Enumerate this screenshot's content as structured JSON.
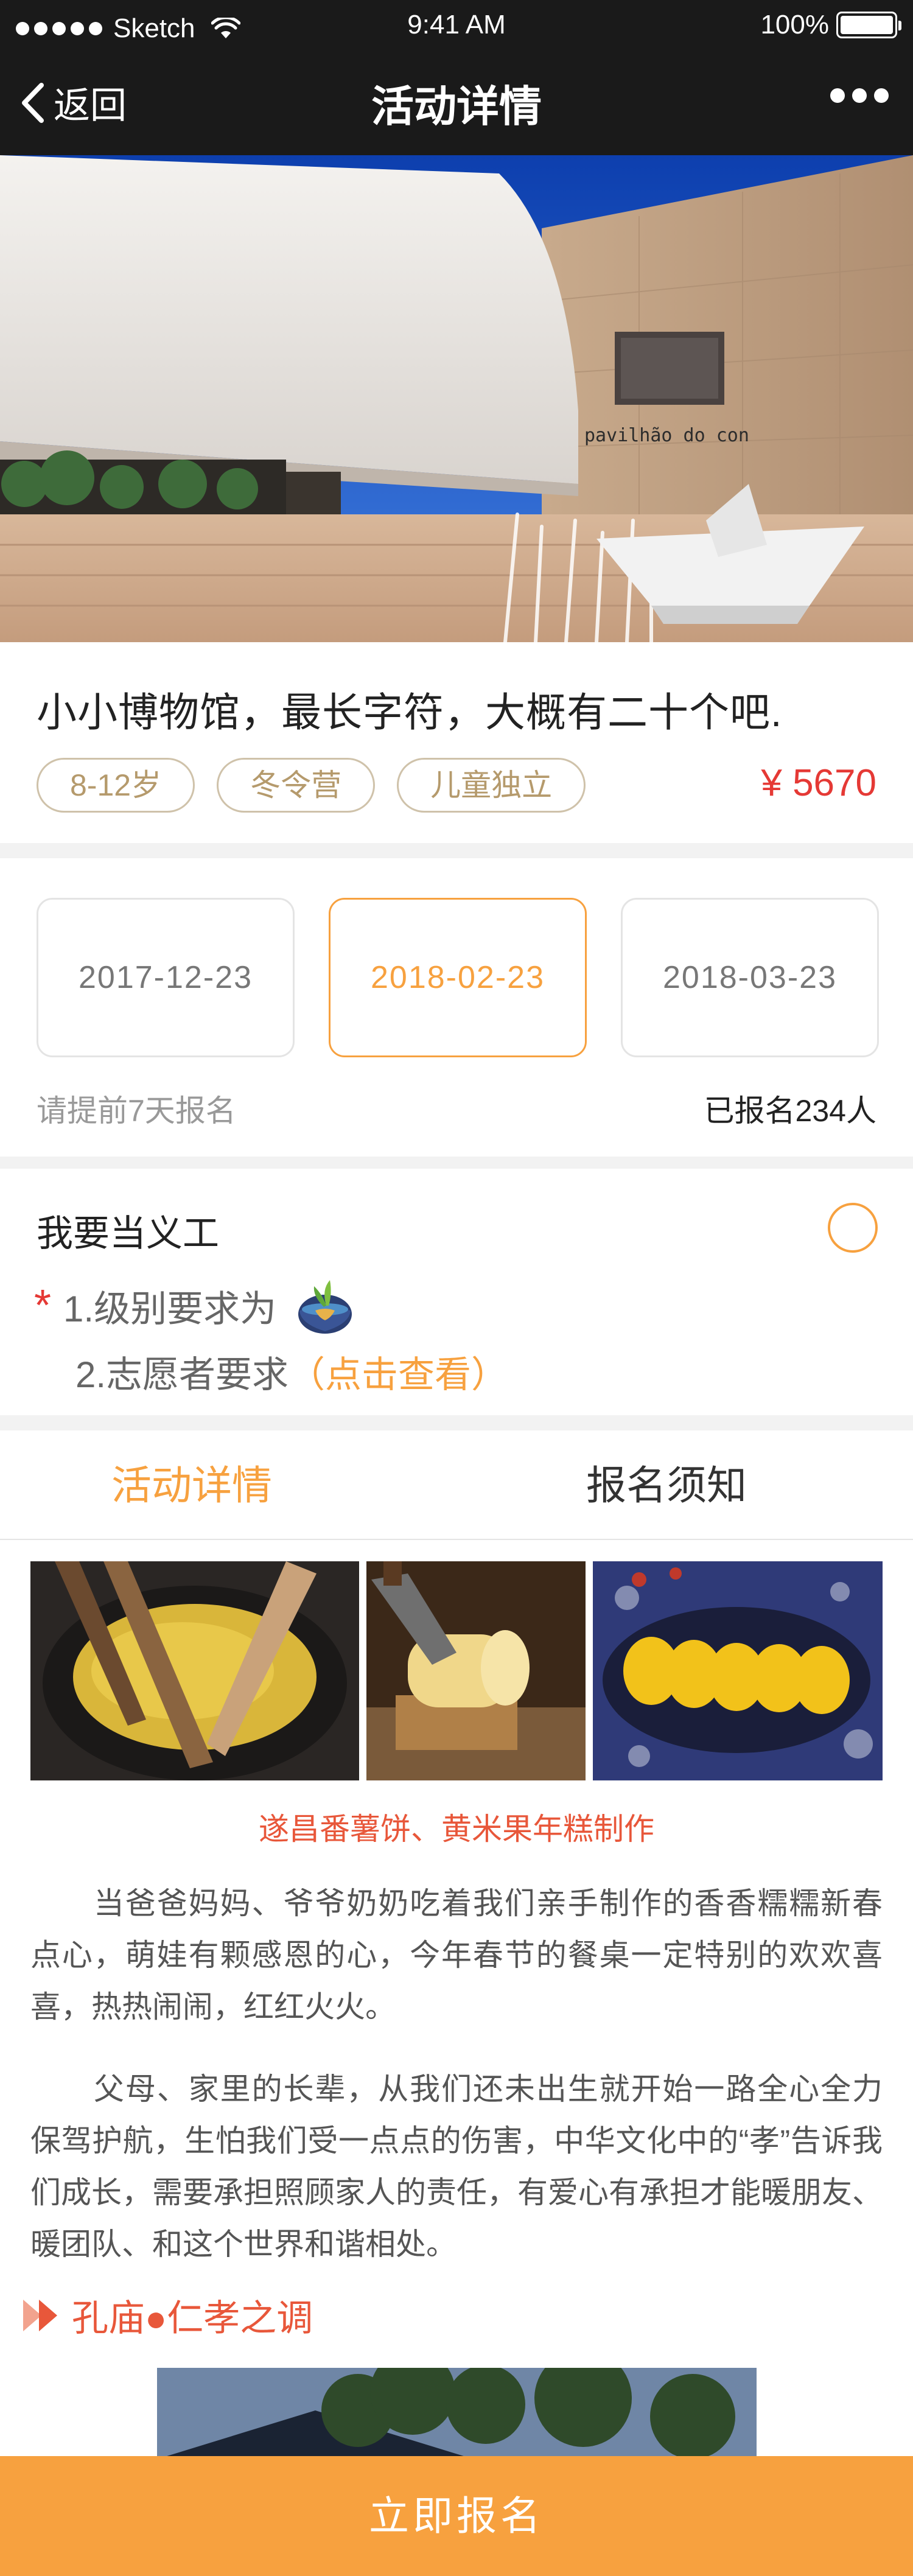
{
  "status_bar": {
    "carrier": "Sketch",
    "time": "9:41 AM",
    "battery": "100%",
    "battery_level": 1.0
  },
  "nav": {
    "back_label": "返回",
    "title": "活动详情"
  },
  "activity": {
    "title": "小小博物馆，最长字符，大概有二十个吧.",
    "tags": [
      "8-12岁",
      "冬令营",
      "儿童独立"
    ],
    "price": "¥ 5670"
  },
  "schedule": {
    "dates": [
      "2017-12-23",
      "2018-02-23",
      "2018-03-23"
    ],
    "selected_index": 1,
    "tip": "请提前7天报名",
    "signed_up": "已报名234人"
  },
  "volunteer": {
    "title": "我要当义工",
    "requirement_1": "1.级别要求为",
    "requirement_2": "2.志愿者要求",
    "requirement_2_link": "（点击查看）"
  },
  "tabs": [
    {
      "label": "活动详情",
      "active": true
    },
    {
      "label": "报名须知",
      "active": false
    }
  ],
  "content": {
    "caption": "遂昌番薯饼、黄米果年糕制作",
    "paragraph_1": "当爸爸妈妈、爷爷奶奶吃着我们亲手制作的香香糯糯新春点心，萌娃有颗感恩的心，今年春节的餐桌一定特别的欢欢喜喜，热热闹闹，红红火火。",
    "paragraph_2": "父母、家里的长辈，从我们还未出生就开始一路全心全力保驾护航，生怕我们受一点点的伤害，中华文化中的“孝”告诉我们成长，需要承担照顾家人的责任，有爱心有承担才能暖朋友、暖团队、和这个世界和谐相处。",
    "section_title": "孔庙●仁孝之调"
  },
  "cta": {
    "label": "立即报名"
  },
  "colors": {
    "accent": "#f7a13f",
    "price_red": "#e53935",
    "caption_red": "#e8573a",
    "tag_gold": "#b59a6c",
    "nav_bg": "#1a1a1a"
  }
}
